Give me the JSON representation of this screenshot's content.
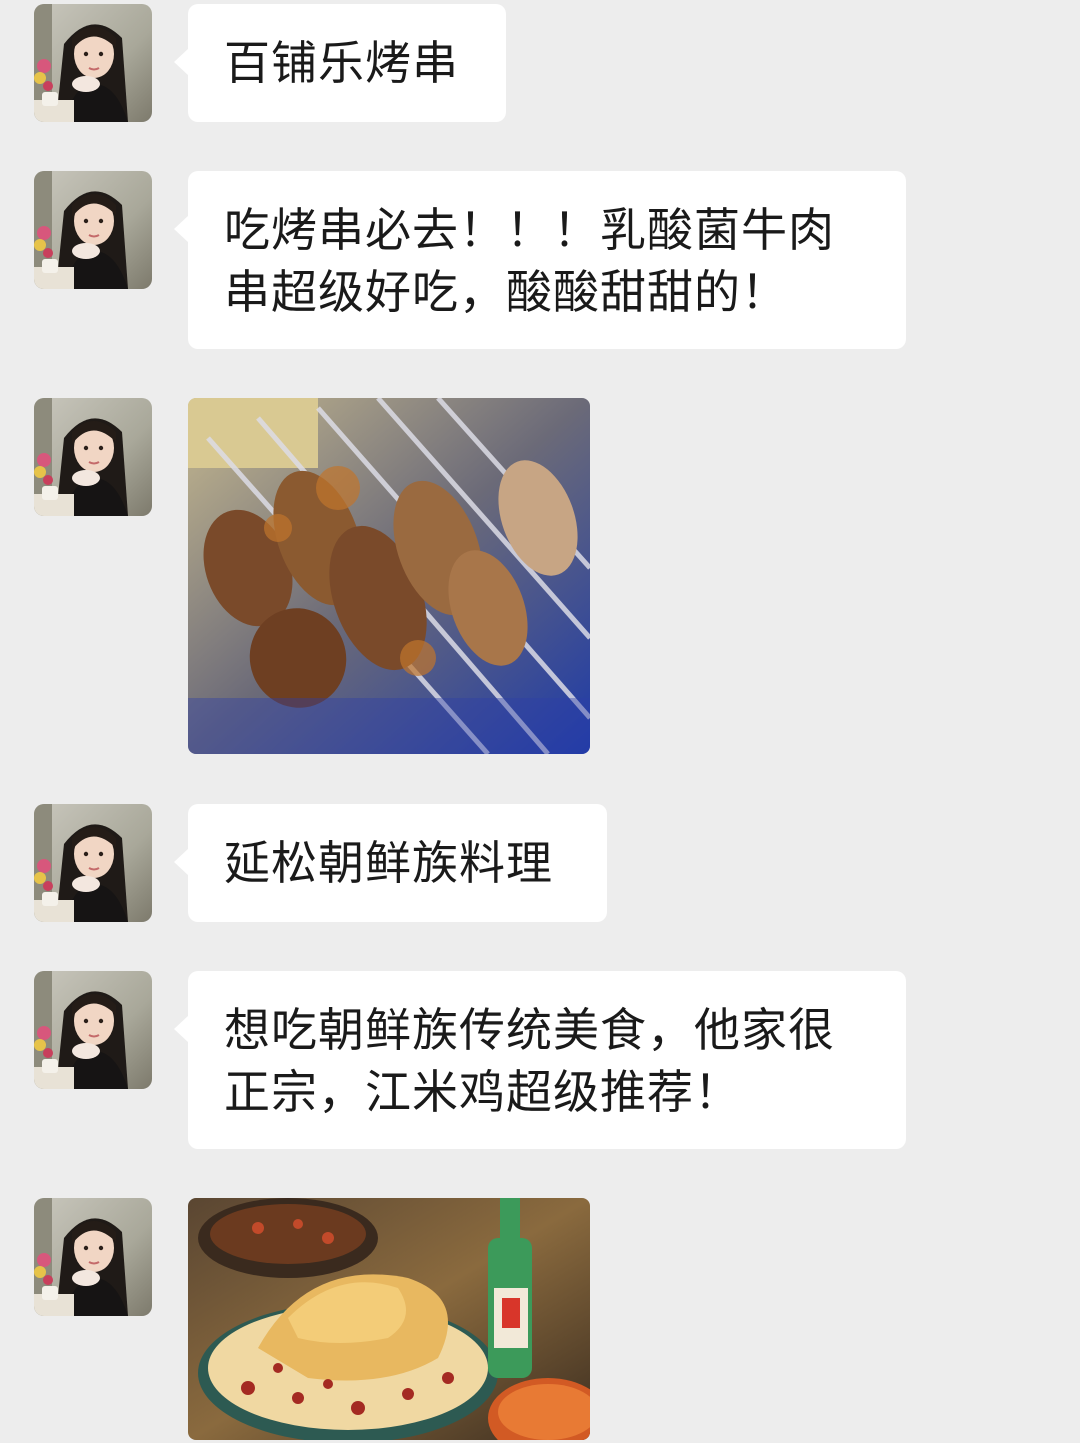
{
  "messages": [
    {
      "type": "text",
      "text": "百铺乐烤串"
    },
    {
      "type": "text",
      "text": "吃烤串必去！！！乳酸菌牛肉串超级好吃，酸酸甜甜的！"
    },
    {
      "type": "image",
      "content": "grilled-skewers-photo"
    },
    {
      "type": "text",
      "text": "延松朝鲜族料理"
    },
    {
      "type": "text",
      "text": "想吃朝鲜族传统美食，他家很正宗，江米鸡超级推荐！"
    },
    {
      "type": "image",
      "content": "korean-food-table-photo"
    }
  ],
  "colors": {
    "background": "#ededed",
    "bubble": "#ffffff",
    "text": "#1a1a1a"
  },
  "icons": {
    "avatar": "user-avatar-portrait"
  }
}
